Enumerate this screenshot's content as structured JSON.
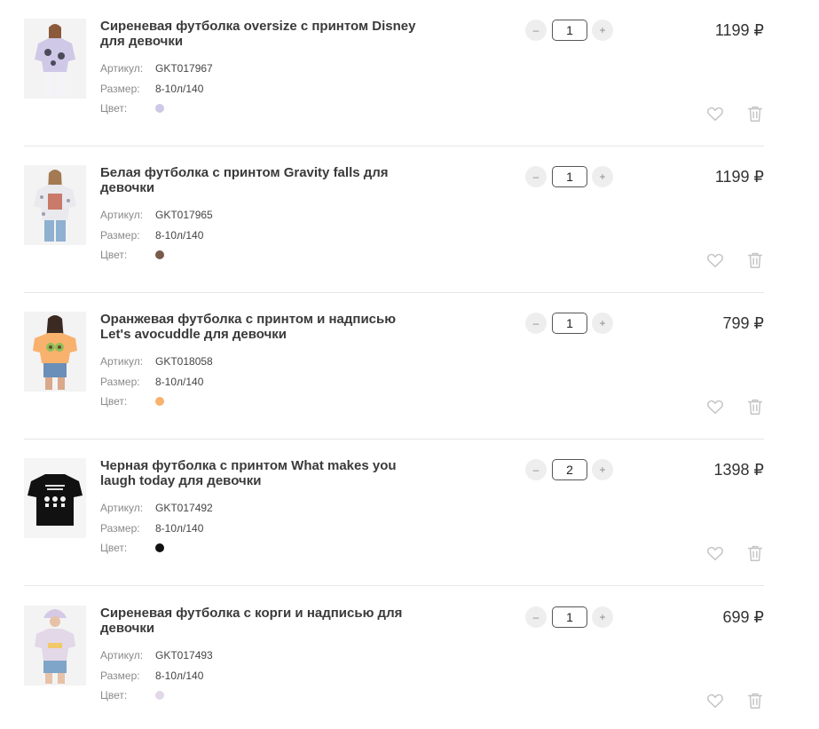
{
  "labels": {
    "sku": "Артикул:",
    "size": "Размер:",
    "color": "Цвет:"
  },
  "qty_controls": {
    "minus": "–",
    "plus": "+"
  },
  "items": [
    {
      "title": "Сиреневая футболка oversize с принтом Disney для девочки",
      "sku": "GKT017967",
      "size": "8-10л/140",
      "color_hex": "#cfc8e6",
      "qty": "1",
      "price": "1199 ₽"
    },
    {
      "title": "Белая футболка с принтом Gravity falls для девочки",
      "sku": "GKT017965",
      "size": "8-10л/140",
      "color_hex": "#7a5a4c",
      "qty": "1",
      "price": "1199 ₽"
    },
    {
      "title": "Оранжевая футболка с принтом и надписью Let's avocuddle для девочки",
      "sku": "GKT018058",
      "size": "8-10л/140",
      "color_hex": "#f8b26e",
      "qty": "1",
      "price": "799 ₽"
    },
    {
      "title": "Черная футболка с принтом What makes you laugh today для девочки",
      "sku": "GKT017492",
      "size": "8-10л/140",
      "color_hex": "#111111",
      "qty": "2",
      "price": "1398 ₽"
    },
    {
      "title": "Сиреневая футболка с корги и надписью для девочки",
      "sku": "GKT017493",
      "size": "8-10л/140",
      "color_hex": "#e2d8e8",
      "qty": "1",
      "price": "699 ₽"
    }
  ],
  "icons": {
    "favorite": "heart-outline-icon",
    "delete": "trash-icon"
  }
}
